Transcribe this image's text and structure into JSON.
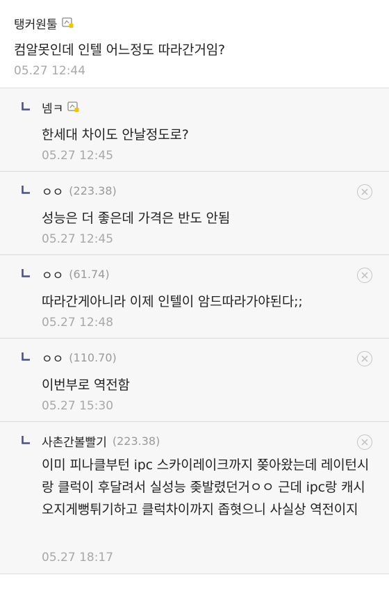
{
  "parent": {
    "nickname": "탱커원툴",
    "body": "컴알못인데 인텔 어느정도 따라간거임?",
    "time": "05.27 12:44"
  },
  "replies": [
    {
      "nickname": "넴ㅋ",
      "ip": "",
      "has_badge": true,
      "deletable": false,
      "body": "한세대 차이도 안날정도로?",
      "time": "05.27 12:45"
    },
    {
      "nickname": "ㅇㅇ",
      "ip": "(223.38)",
      "has_badge": false,
      "deletable": true,
      "body": "성능은 더 좋은데 가격은 반도 안됨",
      "time": "05.27 12:45"
    },
    {
      "nickname": "ㅇㅇ",
      "ip": "(61.74)",
      "has_badge": false,
      "deletable": true,
      "body": "따라간게아니라 이제 인텔이 암드따라가야된다;;",
      "time": "05.27 12:48"
    },
    {
      "nickname": "ㅇㅇ",
      "ip": "(110.70)",
      "has_badge": false,
      "deletable": true,
      "body": "이번부로 역전함",
      "time": "05.27 15:30"
    },
    {
      "nickname": "사촌간볼빨기",
      "ip": "(223.38)",
      "has_badge": false,
      "deletable": true,
      "body": "이미 피나클부턴 ipc 스카이레이크까지 쫒아왔는데 레이턴시랑 클럭이 후달려서 실성능 좆발렸던거ㅇㅇ 근데 ipc랑 캐시 오지게뻥튀기하고 클럭차이까지 좁혓으니 사실상 역전이지",
      "time": "05.27 18:17"
    }
  ],
  "icons": {
    "reply_arrow": "reply-arrow-icon",
    "badge": "fixed-nick-badge-icon",
    "delete": "delete-circle-x-icon"
  },
  "colors": {
    "reply_arrow": "#4a4f8c",
    "reply_bg": "#f7f7f7",
    "time": "#a8a8a8",
    "ip": "#9a9a9a"
  }
}
